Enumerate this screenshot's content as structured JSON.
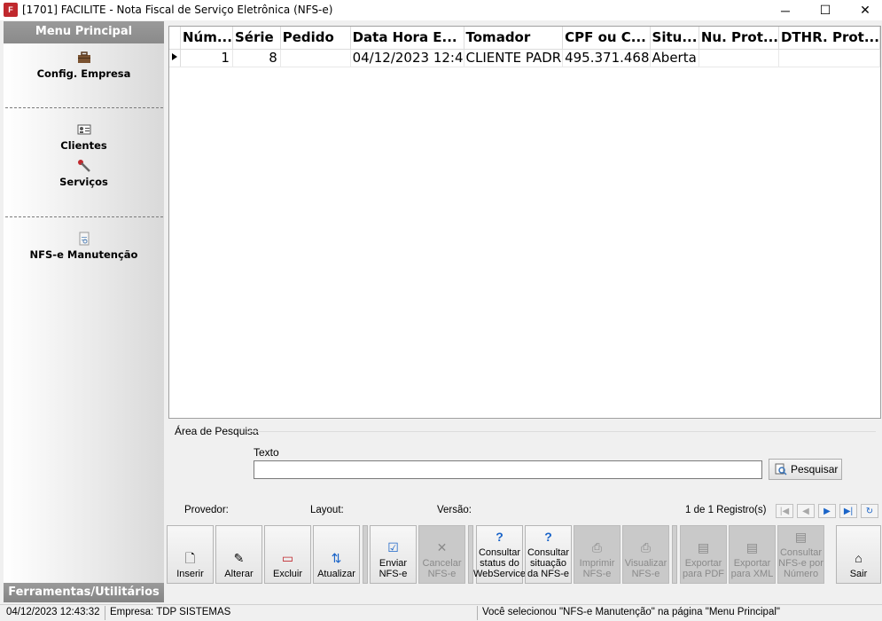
{
  "window": {
    "title": "[1701] FACILITE - Nota Fiscal de Serviço Eletrônica (NFS-e)",
    "app_icon_text": "F",
    "minimize": "─",
    "maximize": "☐",
    "close": "✕"
  },
  "sidebar": {
    "header": "Menu Principal",
    "footer": "Ferramentas/Utilitários",
    "items": [
      {
        "label": "Config. Empresa",
        "icon": "briefcase-icon"
      },
      {
        "label": "Clientes",
        "icon": "contact-card-icon"
      },
      {
        "label": "Serviços",
        "icon": "wrench-icon"
      },
      {
        "label": "NFS-e Manutenção",
        "icon": "document-icon"
      }
    ]
  },
  "grid": {
    "columns": [
      "Núm...",
      "Série",
      "Pedido",
      "Data Hora E...",
      "Tomador",
      "CPF ou C...",
      "Situ...",
      "Nu. Prot...",
      "DTHR. Prot..."
    ],
    "rows": [
      {
        "numero": "1",
        "serie": "8",
        "pedido": "",
        "data_hora": "04/12/2023 12:4",
        "tomador": "CLIENTE PADR",
        "cpf": "495.371.468",
        "situacao": "Aberta",
        "nu_prot": "",
        "dthr_prot": ""
      }
    ]
  },
  "search": {
    "title": "Área de Pesquisa",
    "texto_label": "Texto",
    "texto_value": "",
    "pesquisar": "Pesquisar",
    "provedor_label": "Provedor:",
    "layout_label": "Layout:",
    "versao_label": "Versão:",
    "registros": "1 de 1 Registro(s)"
  },
  "toolbar": {
    "inserir": "Inserir",
    "alterar": "Alterar",
    "excluir": "Excluir",
    "atualizar": "Atualizar",
    "enviar": "Enviar NFS-e",
    "cancelar": "Cancelar NFS-e",
    "consultar_status": "Consultar status do WebService",
    "consultar_situacao": "Consultar situação da NFS-e",
    "imprimir": "Imprimir NFS-e",
    "visualizar": "Visualizar NFS-e",
    "exportar_pdf": "Exportar para PDF",
    "exportar_xml": "Exportar para XML",
    "consultar_numero": "Consultar NFS-e por Número",
    "sair": "Sair"
  },
  "status": {
    "datetime": "04/12/2023 12:43:32",
    "empresa": "Empresa: TDP SISTEMAS",
    "message": "Você selecionou \"NFS-e Manutenção\" na página \"Menu Principal\""
  },
  "colors": {
    "sidebar_header": "#8f8f8f",
    "nav_blue": "#1a64c8",
    "app_icon": "#c0282d"
  }
}
